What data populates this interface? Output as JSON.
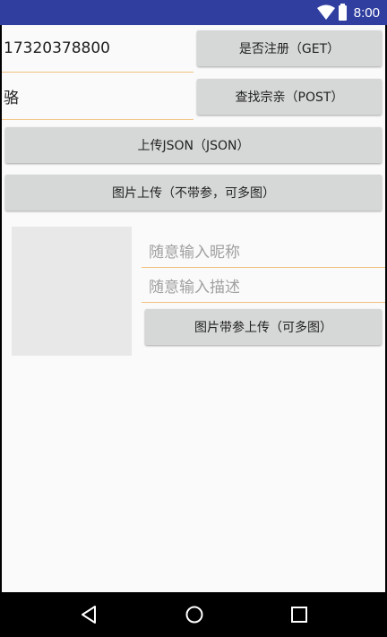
{
  "status_bar": {
    "time": "8:00",
    "icons": [
      "wifi-icon",
      "battery-icon"
    ],
    "color": "#303f9f"
  },
  "form": {
    "phone_value": "17320378800",
    "name_value": "骆",
    "register_button": "是否注册（GET）",
    "find_button": "查找宗亲（POST）",
    "json_button": "上传JSON（JSON）",
    "upload_button": "图片上传（不带参，可多图）"
  },
  "upload_with_params": {
    "nickname_placeholder": "随意输入昵称",
    "description_placeholder": "随意输入描述",
    "upload_button": "图片带参上传（可多图）"
  },
  "nav_bar": {
    "icons": [
      "back-icon",
      "home-icon",
      "recents-icon"
    ]
  },
  "colors": {
    "accent_underline": "#f2c17d",
    "button_bg": "#d6d7d7",
    "page_bg": "#fafafa"
  }
}
